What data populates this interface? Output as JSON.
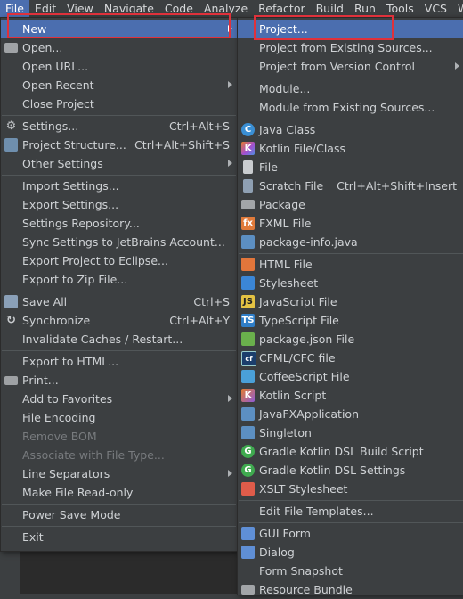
{
  "menubar": {
    "file": "File",
    "edit": "Edit",
    "view": "View",
    "navigate": "Navigate",
    "code": "Code",
    "analyze": "Analyze",
    "refactor": "Refactor",
    "build": "Build",
    "run": "Run",
    "tools": "Tools",
    "vcs": "VCS",
    "window": "Winc"
  },
  "file_menu": {
    "new": "New",
    "open": "Open...",
    "open_url": "Open URL...",
    "open_recent": "Open Recent",
    "close_project": "Close Project",
    "settings": "Settings...",
    "settings_sc": "Ctrl+Alt+S",
    "project_structure": "Project Structure...",
    "project_structure_sc": "Ctrl+Alt+Shift+S",
    "other_settings": "Other Settings",
    "import_settings": "Import Settings...",
    "export_settings": "Export Settings...",
    "settings_repository": "Settings Repository...",
    "sync_settings": "Sync Settings to JetBrains Account...",
    "export_eclipse": "Export Project to Eclipse...",
    "export_zip": "Export to Zip File...",
    "save_all": "Save All",
    "save_all_sc": "Ctrl+S",
    "synchronize": "Synchronize",
    "synchronize_sc": "Ctrl+Alt+Y",
    "invalidate": "Invalidate Caches / Restart...",
    "export_html": "Export to HTML...",
    "print": "Print...",
    "add_favorites": "Add to Favorites",
    "file_encoding": "File Encoding",
    "remove_bom": "Remove BOM",
    "associate": "Associate with File Type...",
    "line_separators": "Line Separators",
    "read_only": "Make File Read-only",
    "power_save": "Power Save Mode",
    "exit": "Exit"
  },
  "new_menu": {
    "project": "Project...",
    "project_existing": "Project from Existing Sources...",
    "project_vcs": "Project from Version Control",
    "module": "Module...",
    "module_existing": "Module from Existing Sources...",
    "java_class": "Java Class",
    "kotlin_class": "Kotlin File/Class",
    "file": "File",
    "scratch": "Scratch File",
    "scratch_sc": "Ctrl+Alt+Shift+Insert",
    "package": "Package",
    "fxml": "FXML File",
    "package_info": "package-info.java",
    "html": "HTML File",
    "stylesheet": "Stylesheet",
    "js": "JavaScript File",
    "ts": "TypeScript File",
    "package_json": "package.json File",
    "cfml": "CFML/CFC file",
    "coffee": "CoffeeScript File",
    "kotlin_script": "Kotlin Script",
    "javafx": "JavaFXApplication",
    "singleton": "Singleton",
    "gradle_build": "Gradle Kotlin DSL Build Script",
    "gradle_settings": "Gradle Kotlin DSL Settings",
    "xslt": "XSLT Stylesheet",
    "edit_templates": "Edit File Templates...",
    "gui_form": "GUI Form",
    "dialog": "Dialog",
    "form_snapshot": "Form Snapshot",
    "resource_bundle": "Resource Bundle"
  },
  "icons": {
    "c": "C",
    "k": "K",
    "fx": "fx",
    "js": "JS",
    "ts": "TS",
    "cf": "cf",
    "g": "G"
  },
  "colors": {
    "selection": "#4b6eaf",
    "highlight": "#e0313b",
    "background": "#3c3f41"
  }
}
